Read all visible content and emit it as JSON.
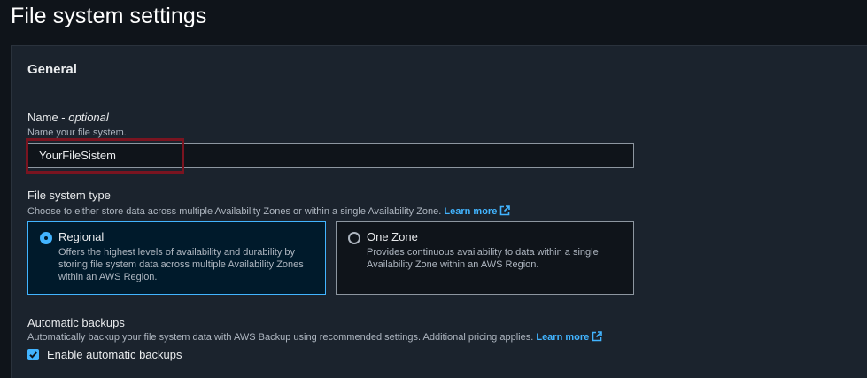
{
  "page": {
    "title": "File system settings"
  },
  "general": {
    "title": "General",
    "name": {
      "label": "Name - ",
      "optional": "optional",
      "description": "Name your file system.",
      "value": "YourFileSistem"
    },
    "fs_type": {
      "label": "File system type",
      "description": "Choose to either store data across multiple Availability Zones or within a single Availability Zone.",
      "learn_more": "Learn more",
      "options": [
        {
          "title": "Regional",
          "desc_lines": [
            "Offers the highest levels of availability and durability by",
            "storing file system data across multiple Availability Zones",
            "within an AWS Region."
          ],
          "selected": true
        },
        {
          "title": "One Zone",
          "desc_lines": [
            "Provides continuous availability to data within a single",
            "Availability Zone within an AWS Region."
          ],
          "selected": false
        }
      ]
    },
    "backups": {
      "label": "Automatic backups",
      "description": "Automatically backup your file system data with AWS Backup using recommended settings. Additional pricing applies.",
      "learn_more": "Learn more",
      "checkbox_label": "Enable automatic backups",
      "checked": true
    }
  },
  "colors": {
    "accent": "#42b4ff",
    "highlight_box": "#7a1420",
    "panel_bg": "#1b232d",
    "page_bg": "#0f141a"
  }
}
